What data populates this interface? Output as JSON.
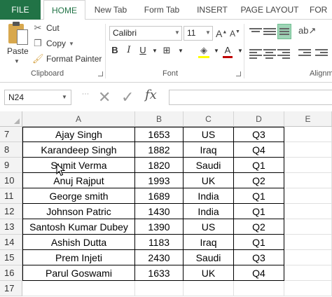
{
  "tabs": {
    "file": "FILE",
    "items": [
      "HOME",
      "New Tab",
      "Form Tab",
      "INSERT",
      "PAGE LAYOUT",
      "FOR"
    ]
  },
  "ribbon": {
    "clipboard": {
      "paste": "Paste",
      "cut": "Cut",
      "copy": "Copy",
      "format_painter": "Format Painter",
      "label": "Clipboard"
    },
    "font": {
      "name": "Calibri",
      "size": "11",
      "label": "Font"
    },
    "alignment": {
      "label": "Alignm"
    }
  },
  "formula_bar": {
    "name_box": "N24",
    "fx": "fx",
    "cancel_icon": "close-icon",
    "enter_icon": "check-icon"
  },
  "grid": {
    "columns": [
      "A",
      "B",
      "C",
      "D",
      "E"
    ],
    "rows": [
      {
        "num": "7",
        "a": "Ajay Singh",
        "b": "1653",
        "c": "US",
        "d": "Q3"
      },
      {
        "num": "8",
        "a": "Karandeep Singh",
        "b": "1882",
        "c": "Iraq",
        "d": "Q4"
      },
      {
        "num": "9",
        "a": "Sumit Verma",
        "b": "1820",
        "c": "Saudi",
        "d": "Q1"
      },
      {
        "num": "10",
        "a": "Anuj Rajput",
        "b": "1993",
        "c": "UK",
        "d": "Q2"
      },
      {
        "num": "11",
        "a": "George smith",
        "b": "1689",
        "c": "India",
        "d": "Q1"
      },
      {
        "num": "12",
        "a": "Johnson Patric",
        "b": "1430",
        "c": "India",
        "d": "Q1"
      },
      {
        "num": "13",
        "a": "Santosh Kumar Dubey",
        "b": "1390",
        "c": "US",
        "d": "Q2"
      },
      {
        "num": "14",
        "a": "Ashish Dutta",
        "b": "1183",
        "c": "Iraq",
        "d": "Q1"
      },
      {
        "num": "15",
        "a": "Prem Injeti",
        "b": "2430",
        "c": "Saudi",
        "d": "Q3"
      },
      {
        "num": "16",
        "a": "Parul Goswami",
        "b": "1633",
        "c": "UK",
        "d": "Q4"
      },
      {
        "num": "17",
        "a": "",
        "b": "",
        "c": "",
        "d": ""
      }
    ]
  },
  "colors": {
    "accent": "#217346",
    "header_bg": "#f3f3f3"
  }
}
